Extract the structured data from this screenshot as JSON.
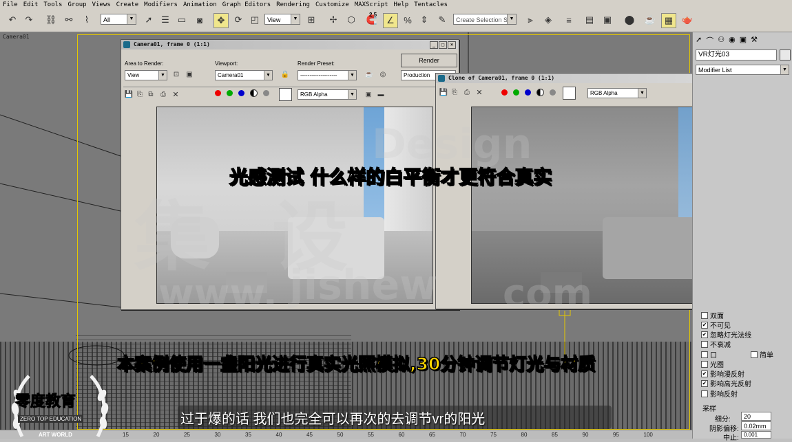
{
  "menu": [
    "File",
    "Edit",
    "Tools",
    "Group",
    "Views",
    "Create",
    "Modifiers",
    "Animation",
    "Graph Editors",
    "Rendering",
    "Customize",
    "MAXScript",
    "Help",
    "Tentacles"
  ],
  "toolbar": {
    "filter_value": "All",
    "view_value": "View",
    "selection_set_placeholder": "Create Selection Set",
    "snap_value": "2.5"
  },
  "viewport": {
    "label": "Camera01"
  },
  "render_window": {
    "title": "Camera01, frame 0 (1:1)",
    "area_label": "Area to Render:",
    "area_value": "View",
    "viewport_label": "Viewport:",
    "viewport_value": "Camera01",
    "preset_label": "Render Preset:",
    "preset_value": "--------------------",
    "render_button": "Render",
    "production_value": "Production",
    "channel_value": "RGB Alpha"
  },
  "clone_window": {
    "title": "Clone of Camera01, frame 0 (1:1)",
    "channel_value": "RGB Alpha"
  },
  "right_panel": {
    "object_name": "VR灯光03",
    "modifier_list": "Modifier List",
    "options": [
      {
        "label": "双面",
        "checked": false
      },
      {
        "label": "不可见",
        "checked": true
      },
      {
        "label": "忽略灯光法线",
        "checked": true
      },
      {
        "label": "不衰减",
        "checked": false
      },
      {
        "label": "口",
        "checked": false
      },
      {
        "label": "简单",
        "checked": false
      },
      {
        "label": "光图",
        "checked": false
      },
      {
        "label": "影响漫反射",
        "checked": true
      },
      {
        "label": "影响高光反射",
        "checked": true
      },
      {
        "label": "影响反射",
        "checked": false
      }
    ],
    "sampling_label": "采样",
    "subdiv_label": "细分:",
    "subdiv_value": "20",
    "shadow_bias_label": "阴影偏移:",
    "shadow_bias_value": "0.02mm",
    "cutoff_label": "中止:",
    "cutoff_value": "0.001"
  },
  "captions": {
    "title": "光感测试 什么样的白平衡才更符合真实",
    "highlight": "本案例使用一盏阳光进行真实光照模拟,30分钟调节灯光与材质",
    "subtitle": "过于爆的话 我们也完全可以再次的去调节vr的阳光"
  },
  "logo": {
    "name": "零度教育",
    "english": "ZERO TOP EDUCATION",
    "footer": "ART WORLD"
  },
  "watermarks": [
    "集",
    "设",
    "Design",
    "www.",
    "jishew",
    "com"
  ],
  "timeline": {
    "ticks": [
      "15",
      "20",
      "25",
      "30",
      "35",
      "40",
      "45",
      "50",
      "55",
      "60",
      "65",
      "70",
      "75",
      "80",
      "85",
      "90",
      "95",
      "100"
    ]
  }
}
